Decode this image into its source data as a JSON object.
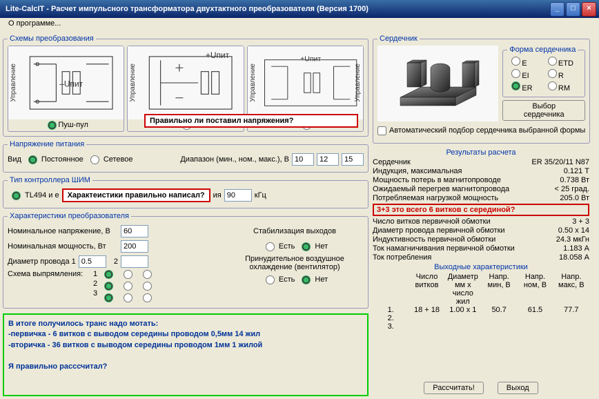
{
  "window": {
    "title": "Lite-CalcIT - Расчет импульсного трансформатора двухтактного преобразователя (Версия 1700)"
  },
  "menu": {
    "about": "О программе..."
  },
  "schemes": {
    "legend": "Схемы преобразования",
    "upit": "+Uпит",
    "minus_upit": "–Uпит",
    "control": "Управление",
    "s1": "Пуш-пул",
    "s2_note": "",
    "s3_note": ""
  },
  "power": {
    "legend": "Напряжение питания",
    "type_label": "Вид",
    "type1": "Постоянное",
    "type2": "Сетевое",
    "range_label": "Диапазон (мин., ном., макс.), В",
    "min": "10",
    "nom": "12",
    "max": "15"
  },
  "pwm": {
    "legend": "Тип контроллера ШИМ",
    "c1": "TL494 и е",
    "note2": "Характеистики правильно написал?",
    "freq_suffix": "ия",
    "freq_val": "90",
    "freq_unit": "кГц"
  },
  "conv": {
    "legend": "Характеристики преобразователя",
    "v_label": "Номинальное напряжение, В",
    "v": "60",
    "p_label": "Номинальная мощность, Вт",
    "p": "200",
    "wire_label": "Диаметр провода 1",
    "wire": "0.5",
    "wire2_label": "2",
    "rect_label": "Схема выпрямления:",
    "stab_label": "Стабилизация выходов",
    "cool_label": "Принудительное воздушное охлаждение (вентилятор)",
    "yes": "Есть",
    "no": "Нет",
    "n1": "1",
    "n2": "2",
    "n3": "3"
  },
  "annot": {
    "red1": "Правильно ли поставил напряжения?",
    "green": "В итоге получилось транс надо мотать:\n-первичка - 6 витков  с выводом середины проводом 0,5мм 14 жил\n-вторичка -  36 витков с выводом середины проводом 1мм 1 жилой\n\nЯ правильно расссчитал?"
  },
  "core": {
    "legend": "Сердечник",
    "shape_legend": "Форма сердечника",
    "shapes": {
      "E": "E",
      "ETD": "ETD",
      "EI": "EI",
      "R": "R",
      "ER": "ER",
      "RM": "RM"
    },
    "pick_btn": "Выбор сердечника",
    "auto_label": "Автоматический подбор сердечника выбранной формы"
  },
  "result": {
    "legend": "Результаты расчета",
    "rows": [
      [
        "Сердечник",
        "ER 35/20/11 N87"
      ],
      [
        "Индукция, максимальная",
        "0.121 Т"
      ],
      [
        "Мощность потерь в магнитопроводе",
        "0.738 Вт"
      ],
      [
        "Ожидаемый перегрев магнитопровода",
        "< 25 град."
      ],
      [
        "Потребляемая нагрузкой мощность",
        "205.0 Вт"
      ]
    ],
    "red_note": "3+3 это  всего 6 витков с серединой?",
    "rows2": [
      [
        "Число витков первичной обмотки",
        "3 + 3"
      ],
      [
        "Диаметр провода первичной обмотки",
        "0.50 x 14"
      ],
      [
        "Индуктивность первичной обмотки",
        "24.3 мкГн"
      ],
      [
        "Ток намагничивания первичной обмотки",
        "1.183 А"
      ],
      [
        "Ток потребления",
        "18.058 А"
      ]
    ],
    "out_legend": "Выходные характеристики",
    "out_headers": [
      "",
      "Число витков",
      "Диаметр мм х число жил",
      "Напр. мин, В",
      "Напр. ном, В",
      "Напр. макс, В"
    ],
    "out_rows": [
      [
        "1.",
        "18 + 18",
        "1.00 x 1",
        "50.7",
        "61.5",
        "77.7"
      ],
      [
        "2.",
        "",
        "",
        "",
        "",
        ""
      ],
      [
        "3.",
        "",
        "",
        "",
        "",
        ""
      ]
    ]
  },
  "buttons": {
    "calc": "Рассчитать!",
    "exit": "Выход"
  }
}
